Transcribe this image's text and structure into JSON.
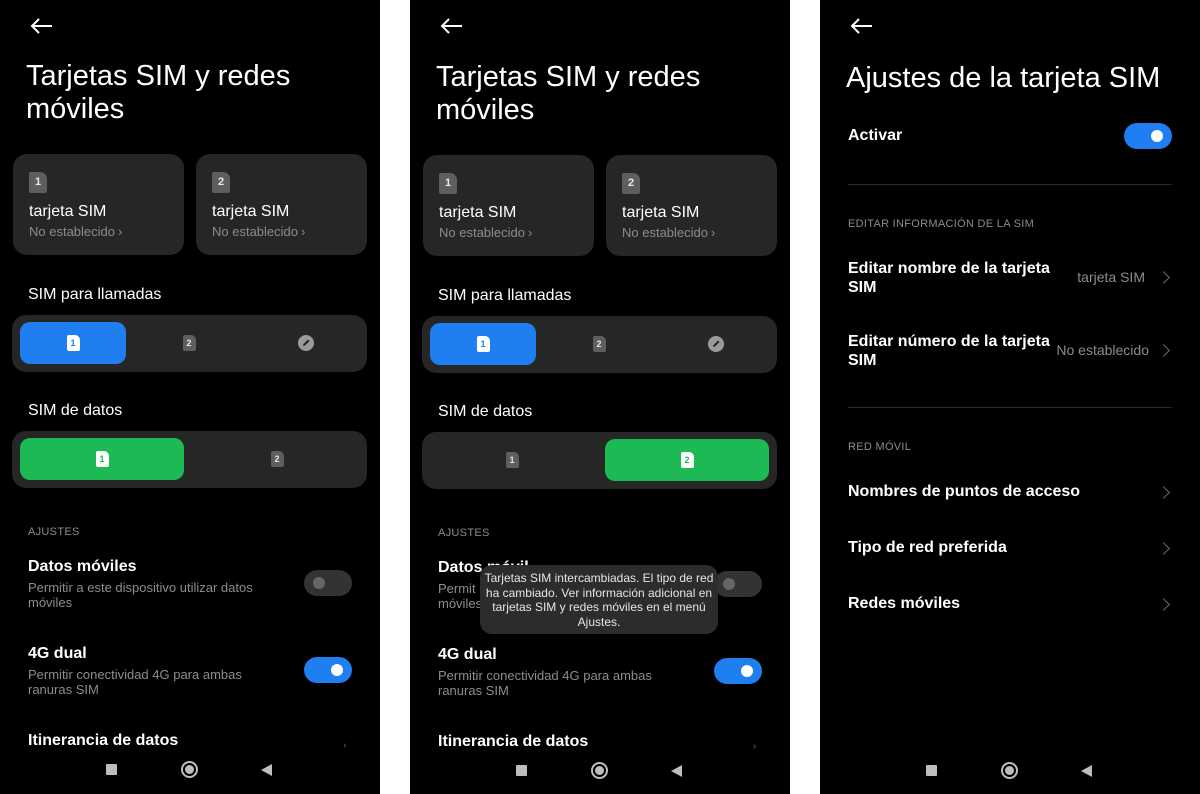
{
  "panel1": {
    "title": "Tarjetas SIM y redes móviles",
    "sim_cards": [
      {
        "number": "1",
        "name": "tarjeta SIM",
        "status": "No establecido"
      },
      {
        "number": "2",
        "name": "tarjeta SIM",
        "status": "No establecido"
      }
    ],
    "calls_label": "SIM para llamadas",
    "calls_options": [
      "1",
      "2"
    ],
    "data_label": "SIM de datos",
    "data_options": [
      "1",
      "2"
    ],
    "settings_category": "AJUSTES",
    "mobile_data": {
      "title": "Datos móviles",
      "description": "Permitir a este dispositivo utilizar datos móviles",
      "enabled": false
    },
    "dual_4g": {
      "title": "4G dual",
      "description": "Permitir conectividad 4G para ambas ranuras SIM",
      "enabled": true
    },
    "roaming": {
      "title": "Itinerancia de datos"
    }
  },
  "panel2": {
    "title": "Tarjetas SIM y redes móviles",
    "sim_cards": [
      {
        "number": "1",
        "name": "tarjeta SIM",
        "status": "No establecido"
      },
      {
        "number": "2",
        "name": "tarjeta SIM",
        "status": "No establecido"
      }
    ],
    "calls_label": "SIM para llamadas",
    "calls_options": [
      "1",
      "2"
    ],
    "data_label": "SIM de datos",
    "data_options": [
      "1",
      "2"
    ],
    "settings_category": "AJUSTES",
    "mobile_data": {
      "title": "Datos móvil",
      "description_line1": "Permit",
      "description_line2": "móviles",
      "enabled": false
    },
    "toast": "Tarjetas SIM intercambiadas. El tipo de red ha cambiado. Ver información adicional en tarjetas SIM y redes móviles en el menú Ajustes.",
    "dual_4g": {
      "title": "4G dual",
      "description": "Permitir conectividad 4G para ambas ranuras SIM",
      "enabled": true
    },
    "roaming": {
      "title": "Itinerancia de datos"
    }
  },
  "panel3": {
    "title": "Ajustes de la tarjeta SIM",
    "activate": {
      "label": "Activar",
      "enabled": true
    },
    "edit_category": "EDITAR INFORMACIÓN DE LA SIM",
    "edit_name": {
      "label": "Editar nombre de la tarjeta SIM",
      "value": "tarjeta SIM"
    },
    "edit_number": {
      "label": "Editar número de la tarjeta SIM",
      "value": "No establecido"
    },
    "network_category": "RED MÓVIL",
    "network_items": [
      "Nombres de puntos de acceso",
      "Tipo de red preferida",
      "Redes móviles"
    ]
  },
  "colors": {
    "accent_blue": "#1f7ff0",
    "accent_green": "#1db954",
    "card": "#262626",
    "background": "#000000"
  },
  "icons": [
    "back-arrow-icon",
    "sim-card-icon",
    "pencil-icon",
    "chevron-right-icon",
    "recents-icon",
    "home-icon",
    "back-triangle-icon"
  ]
}
